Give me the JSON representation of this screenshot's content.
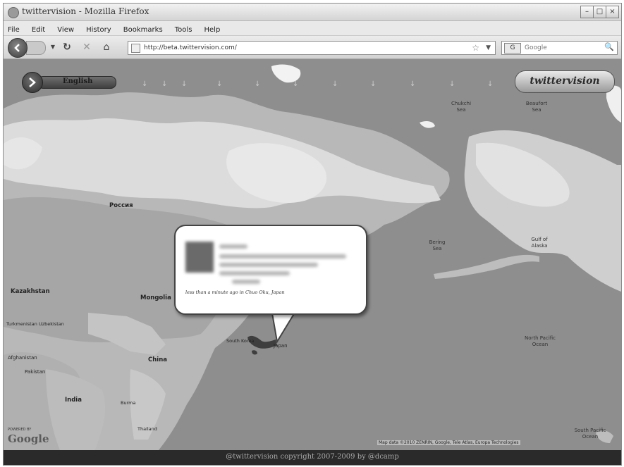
{
  "browser": {
    "title": "twittervision - Mozilla Firefox",
    "menu": [
      "File",
      "Edit",
      "View",
      "History",
      "Bookmarks",
      "Tools",
      "Help"
    ],
    "url": "http://beta.twittervision.com/",
    "search_placeholder": "Google",
    "search_engine_icon": "G"
  },
  "page": {
    "language_label": "English",
    "logo_text": "twittervision",
    "tweet": {
      "meta": "less than a minute ago in Chuo Oku, Japan"
    },
    "map": {
      "labels": {
        "russia": "Россия",
        "kazakhstan": "Kazakhstan",
        "mongolia": "Mongolia",
        "china": "China",
        "india": "India",
        "japan": "Japan",
        "afghanistan": "Afghanistan",
        "pakistan": "Pakistan",
        "turkmenistan": "Turkmenistan",
        "uzbekistan": "Uzbekistan",
        "south_korea": "South Korea",
        "burma": "Burma",
        "thailand": "Thailand",
        "chukchi_sea": "Chukchi Sea",
        "beaufort_sea": "Beaufort Sea",
        "bering_sea": "Bering Sea",
        "gulf_alaska": "Gulf of Alaska",
        "north_pacific": "North Pacific Ocean",
        "south_pacific": "South Pacific Ocean"
      },
      "powered_by": "POWERED BY",
      "google_logo": "Google",
      "attribution": "Map data ©2010 ZENRIN, Google, Tele Atlas, Europa Technologies"
    },
    "footer": "@twittervision copyright 2007-2009 by @dcamp"
  }
}
